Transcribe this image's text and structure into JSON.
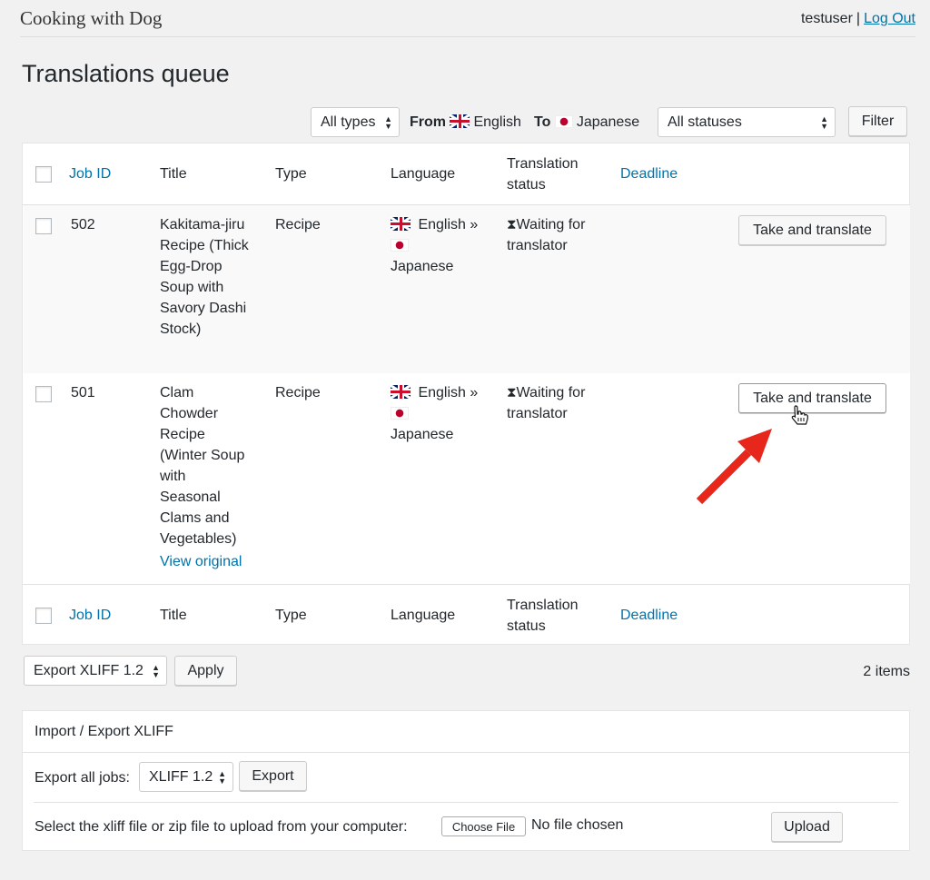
{
  "header": {
    "site_title": "Cooking with Dog",
    "username": "testuser",
    "separator": "|",
    "logout_label": "Log Out"
  },
  "page_title": "Translations queue",
  "filters": {
    "types_selected": "All types",
    "from_label": "From",
    "from_language": "English",
    "to_label": "To",
    "to_language": "Japanese",
    "status_selected": "All statuses",
    "filter_button": "Filter"
  },
  "table": {
    "columns": {
      "job_id": "Job ID",
      "title": "Title",
      "type": "Type",
      "language": "Language",
      "status_line1": "Translation",
      "status_line2": "status",
      "deadline": "Deadline"
    },
    "rows": [
      {
        "job_id": "502",
        "title_lines": [
          "Kakitama-jiru",
          "Recipe (Thick",
          "Egg-Drop",
          "Soup with",
          "Savory Dashi",
          "Stock)"
        ],
        "type": "Recipe",
        "language_from": "English »",
        "language_to": "Japanese",
        "status_line1": "Waiting for",
        "status_line2": "translator",
        "action": "Take and translate"
      },
      {
        "job_id": "501",
        "title_lines": [
          "Clam",
          "Chowder",
          "Recipe",
          "(Winter Soup",
          "with",
          "Seasonal",
          "Clams and",
          "Vegetables)"
        ],
        "view_original": "View original",
        "type": "Recipe",
        "language_from": "English »",
        "language_to": "Japanese",
        "status_line1": "Waiting for",
        "status_line2": "translator",
        "action": "Take and translate"
      }
    ]
  },
  "bulk": {
    "export_selected": "Export XLIFF 1.2",
    "apply_button": "Apply",
    "items_count": "2 items"
  },
  "import_export": {
    "title": "Import / Export XLIFF",
    "export_all_label": "Export all jobs:",
    "format_selected": "XLIFF 1.2",
    "export_button": "Export",
    "upload_label": "Select the xliff file or zip file to upload from your computer:",
    "choose_file_button": "Choose File",
    "no_file_text": "No file chosen",
    "upload_button": "Upload"
  },
  "colors": {
    "link": "#0073aa",
    "annotation_arrow": "#e8271c"
  }
}
